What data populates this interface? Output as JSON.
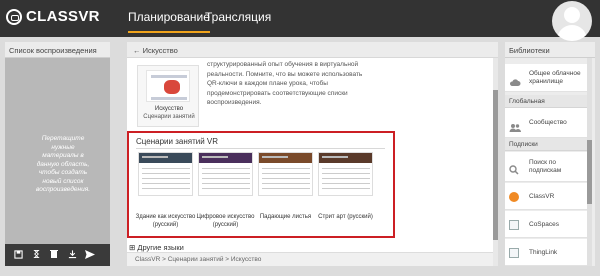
{
  "app": {
    "logo_text": "CLASSVR"
  },
  "nav": {
    "planning": "Планирование",
    "broadcast": "Трансляция"
  },
  "left_panel": {
    "title": "Список воспроизведения",
    "drop_hint": "Перетащите нужные материалы в данную область, чтобы создать новый список воспроизведения."
  },
  "center": {
    "back_label": "Искусство",
    "art_card": {
      "title": "Искусство",
      "subtitle": "Сценарии занятий"
    },
    "description": "структурированный опыт обучения в виртуальной реальности. Помните, что вы можете использовать QR-ключи в каждом плане урока, чтобы продемонстрировать соответствующие списки воспроизведения.",
    "scenarios_title": "Сценарии занятий VR",
    "scenarios": [
      {
        "label": "Здание как искусство (русский)"
      },
      {
        "label": "Цифровое искусство (русский)"
      },
      {
        "label": "Падающие листья"
      },
      {
        "label": "Стрит арт (русский)"
      }
    ],
    "other_languages": "Другие языки",
    "breadcrumb": "ClassVR > Сценарии занятий > Искусство"
  },
  "right_panel": {
    "title": "Библиотеки",
    "items": [
      {
        "label": "Общее облачное хранилище",
        "icon": "cloud-icon"
      },
      {
        "section": "Глобальная"
      },
      {
        "label": "Сообщество",
        "icon": "community-icon"
      },
      {
        "section": "Подписки"
      },
      {
        "label": "Поиск по подпискам",
        "icon": "search-icon"
      },
      {
        "label": "ClassVR",
        "icon": "classvr-icon"
      },
      {
        "label": "CoSpaces",
        "icon": "cospaces-icon"
      },
      {
        "label": "ThingLink",
        "icon": "thinglink-icon"
      }
    ]
  },
  "colors": {
    "accent": "#f0a41c",
    "highlight_border": "#cc1f24",
    "topbar": "#333333"
  }
}
